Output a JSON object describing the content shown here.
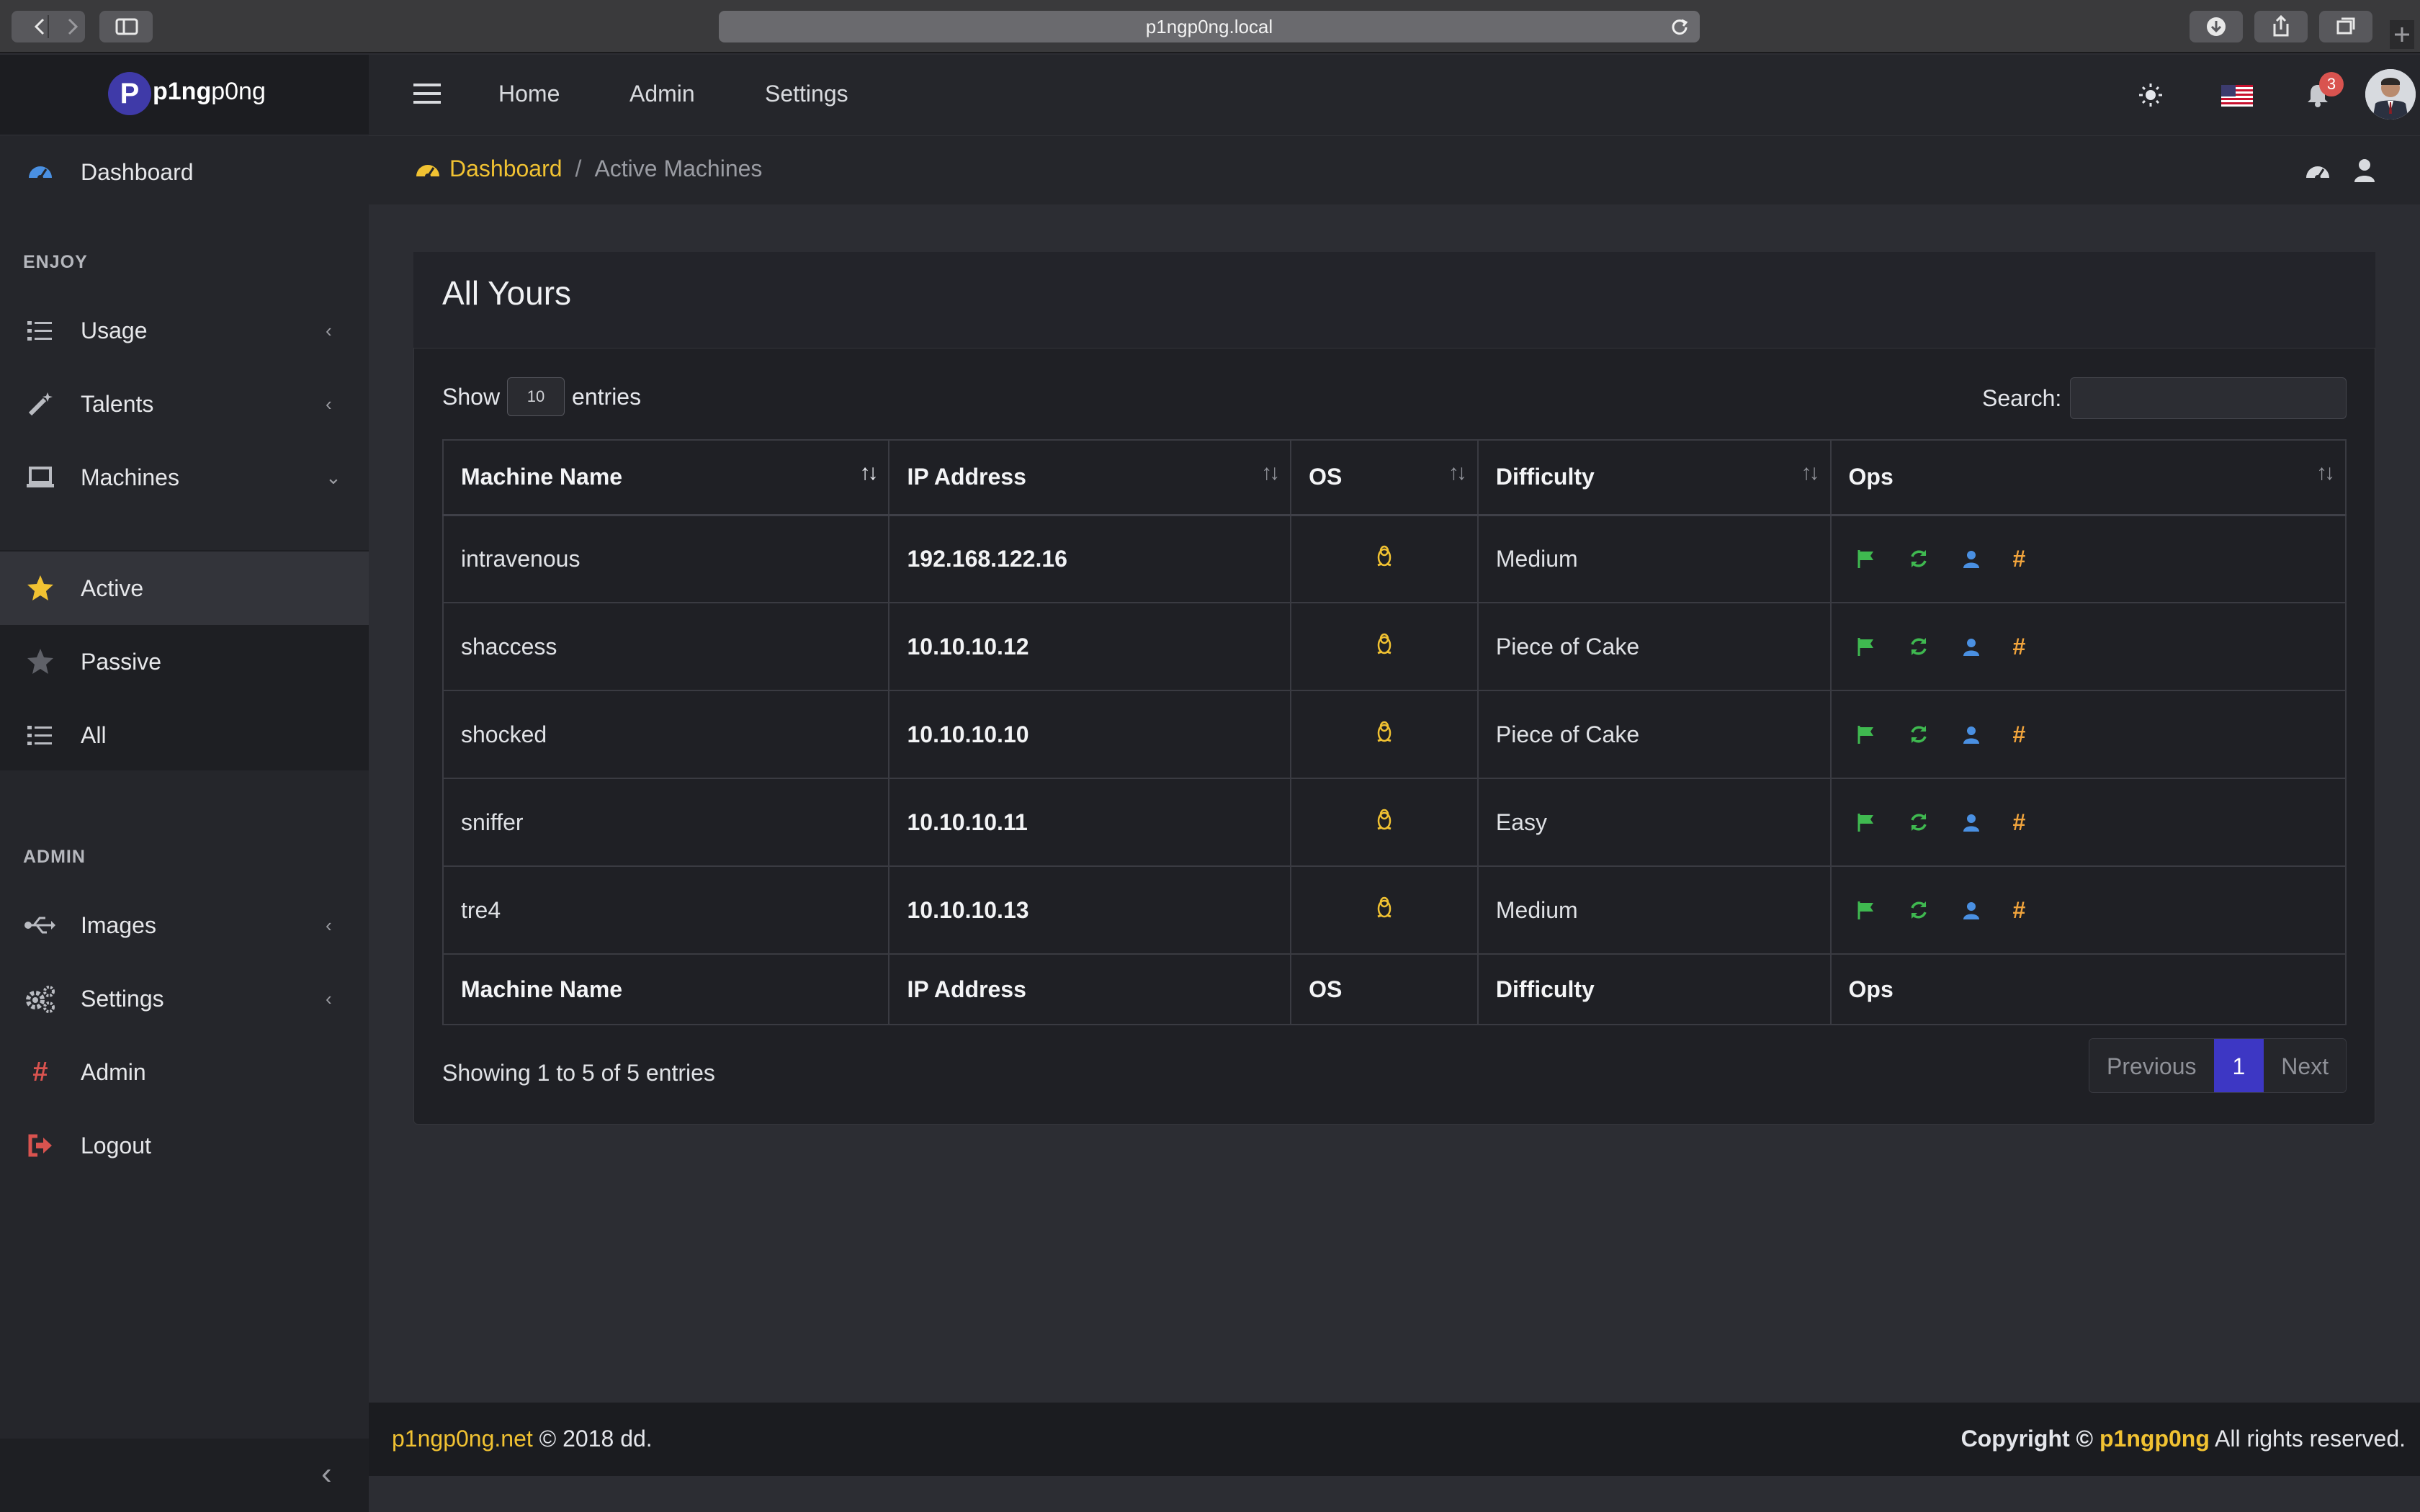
{
  "browser": {
    "url": "p1ngp0ng.local"
  },
  "brand": {
    "logo_letter": "P",
    "name_bold": "p1ng",
    "name_rest": "p0ng"
  },
  "sidebar": {
    "dashboard": "Dashboard",
    "section_enjoy": "ENJOY",
    "usage": "Usage",
    "talents": "Talents",
    "machines": "Machines",
    "active": "Active",
    "passive": "Passive",
    "all": "All",
    "section_admin": "ADMIN",
    "images": "Images",
    "settings": "Settings",
    "admin": "Admin",
    "logout": "Logout"
  },
  "topnav": {
    "home": "Home",
    "admin": "Admin",
    "settings": "Settings",
    "notification_count": "3"
  },
  "breadcrumb": {
    "root": "Dashboard",
    "separator": "/",
    "current": "Active Machines"
  },
  "card": {
    "title": "All Yours",
    "show_label": "Show",
    "page_size": "10",
    "entries_label": "entries",
    "search_label": "Search:",
    "search_value": "",
    "columns": [
      "Machine Name",
      "IP Address",
      "OS",
      "Difficulty",
      "Ops"
    ],
    "rows": [
      {
        "name": "intravenous",
        "ip": "192.168.122.16",
        "os": "linux",
        "difficulty": "Medium"
      },
      {
        "name": "shaccess",
        "ip": "10.10.10.12",
        "os": "linux",
        "difficulty": "Piece of Cake"
      },
      {
        "name": "shocked",
        "ip": "10.10.10.10",
        "os": "linux",
        "difficulty": "Piece of Cake"
      },
      {
        "name": "sniffer",
        "ip": "10.10.10.11",
        "os": "linux",
        "difficulty": "Easy"
      },
      {
        "name": "tre4",
        "ip": "10.10.10.13",
        "os": "linux",
        "difficulty": "Medium"
      }
    ],
    "info": "Showing 1 to 5 of 5 entries",
    "pager": {
      "previous": "Previous",
      "current": "1",
      "next": "Next"
    }
  },
  "footer": {
    "left_link": "p1ngp0ng.net",
    "left_rest": "© 2018 dd.",
    "right_prefix": "Copyright ©",
    "right_brand": "p1ngp0ng",
    "right_suffix": "All rights reserved."
  },
  "colors": {
    "accent": "#f1c232",
    "primary": "#3d37c4",
    "flag": "#3fb950",
    "refresh": "#3fb950",
    "user": "#4a90e2",
    "hash": "#f1a43c"
  }
}
